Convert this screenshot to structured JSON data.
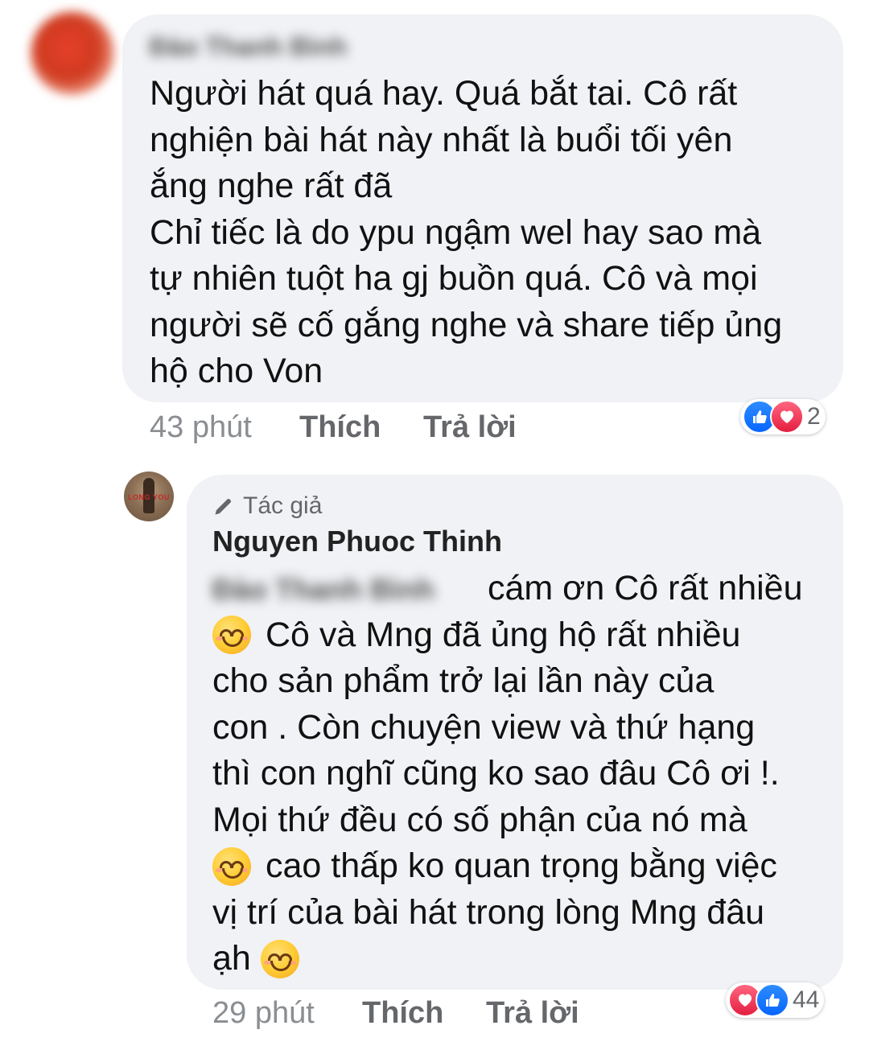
{
  "comment1": {
    "author_blurred": "Đào Thanh Bình",
    "lines": [
      "Người hát quá hay. Quá bắt tai. Cô rất",
      "nghiện bài hát này nhất là buổi tối yên",
      "ắng nghe rất đã",
      "Chỉ tiếc là do ypu ngậm wel hay sao mà",
      "tự nhiên tuột ha gj buồn quá. Cô và mọi",
      "người sẽ cố gắng nghe và share tiếp ủng",
      "hộ cho Von"
    ],
    "time": "43 phút",
    "like_label": "Thích",
    "reply_label": "Trả lời",
    "reaction_count": "2",
    "reaction_icons": [
      "like-icon",
      "love-icon"
    ]
  },
  "comment2": {
    "author_badge": "Tác giả",
    "author_name": "Nguyen Phuoc Thinh",
    "mention_blurred": "Đào Thanh Bình",
    "lines": [
      "cám ơn Cô rất nhiều",
      "Cô và Mng đã ủng hộ rất nhiều",
      "cho sản phẩm trở lại lần này của",
      "con . Còn chuyện view và thứ hạng",
      "thì con nghĩ cũng ko sao đâu Cô ơi !.",
      "Mọi thứ đều có số phận của nó mà",
      "cao thấp ko quan trọng bằng việc",
      "vị trí của bài hát trong lòng Mng đâu",
      "ạh"
    ],
    "time": "29 phút",
    "like_label": "Thích",
    "reply_label": "Trả lời",
    "reaction_count": "44",
    "reaction_icons": [
      "love-icon",
      "like-icon"
    ],
    "avatar_text": "LONG YOU"
  }
}
